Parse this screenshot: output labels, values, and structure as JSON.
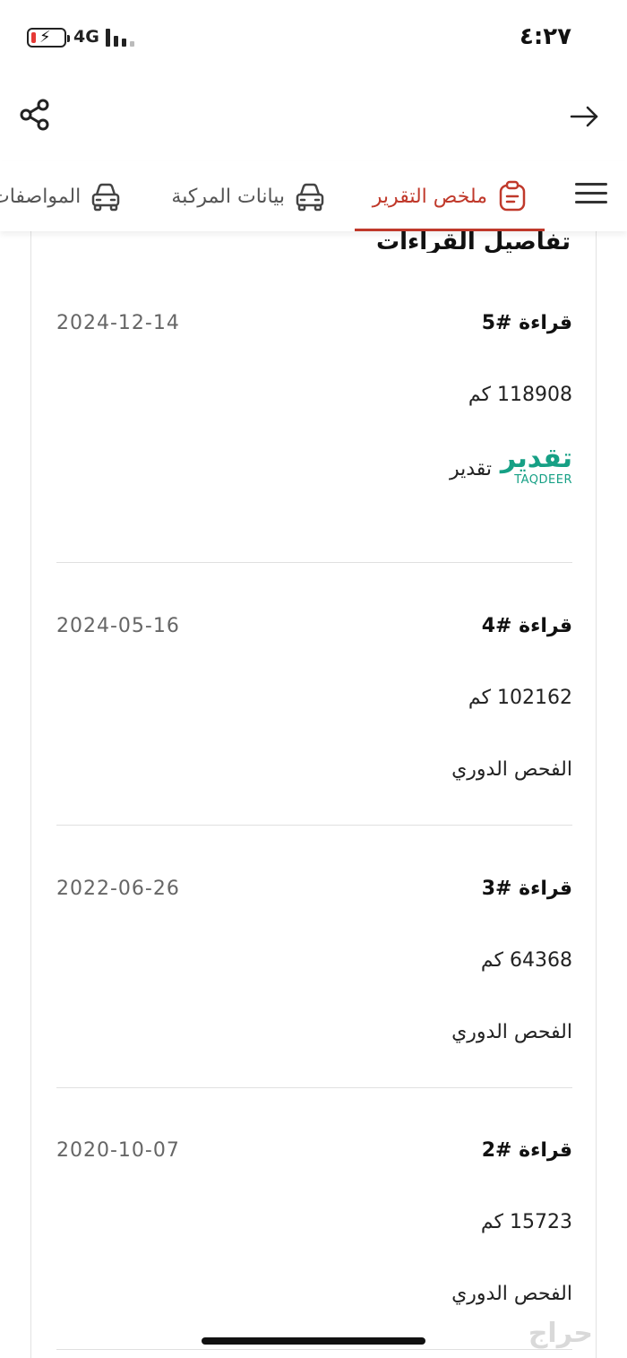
{
  "status_bar": {
    "time": "٤:٢٧",
    "network": "4G",
    "battery_level": 0.15
  },
  "header": {
    "share_icon": "share-icon",
    "back_icon": "arrow-right-icon"
  },
  "tabs": [
    {
      "label": "ملخص التقرير",
      "icon": "clipboard-icon",
      "active": true
    },
    {
      "label": "بيانات المركبة",
      "icon": "car-icon",
      "active": false
    },
    {
      "label": "المواصفات",
      "icon": "car-icon",
      "active": false
    }
  ],
  "section": {
    "title": "تفاصيل القراءات"
  },
  "readings": [
    {
      "title": "قراءة #5",
      "date": "2024-12-14",
      "km": "118908 كم",
      "source": "تقدير",
      "logo_ar": "تقدير",
      "logo_en": "TAQDEER"
    },
    {
      "title": "قراءة #4",
      "date": "2024-05-16",
      "km": "102162 كم",
      "source": "الفحص الدوري"
    },
    {
      "title": "قراءة #3",
      "date": "2022-06-26",
      "km": "64368 كم",
      "source": "الفحص الدوري"
    },
    {
      "title": "قراءة #2",
      "date": "2020-10-07",
      "km": "15723 كم",
      "source": "الفحص الدوري"
    }
  ],
  "watermark": "حراج",
  "colors": {
    "accent": "#c0392b",
    "taqdeer_green": "#16a085",
    "battery_low": "#e53935"
  }
}
